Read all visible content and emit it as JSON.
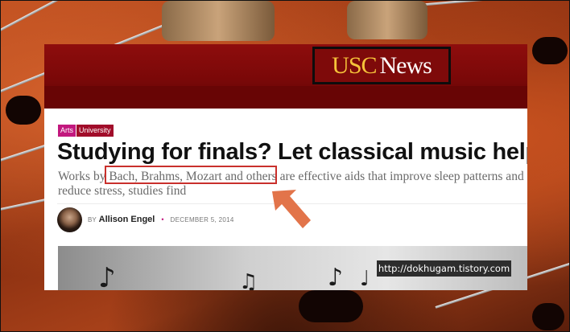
{
  "site": {
    "logo_usc": "USC",
    "logo_news": "News"
  },
  "article": {
    "tags": [
      "Arts",
      "University"
    ],
    "headline": "Studying for finals? Let classical music help",
    "dek_before": "Works by ",
    "dek_highlight": "Bach, Brahms, Mozart and others",
    "dek_after": " are effective aids that improve sleep patterns and reduce stress, studies find",
    "by_prefix": "BY",
    "author": "Allison Engel",
    "separator": "•",
    "date": "DECEMBER 5, 2014"
  },
  "watermark": "http://dokhugam.tistory.com",
  "colors": {
    "masthead": "#7a0808",
    "logo_gold": "#f6c33a",
    "tag_arts": "#c2187e",
    "tag_university": "#a10d2a",
    "highlight_box": "#c9302c",
    "arrow": "#e2744a"
  },
  "icons": {
    "arrow": "arrow-up-left-icon",
    "avatar": "author-avatar",
    "notes": "music-note-icon"
  }
}
